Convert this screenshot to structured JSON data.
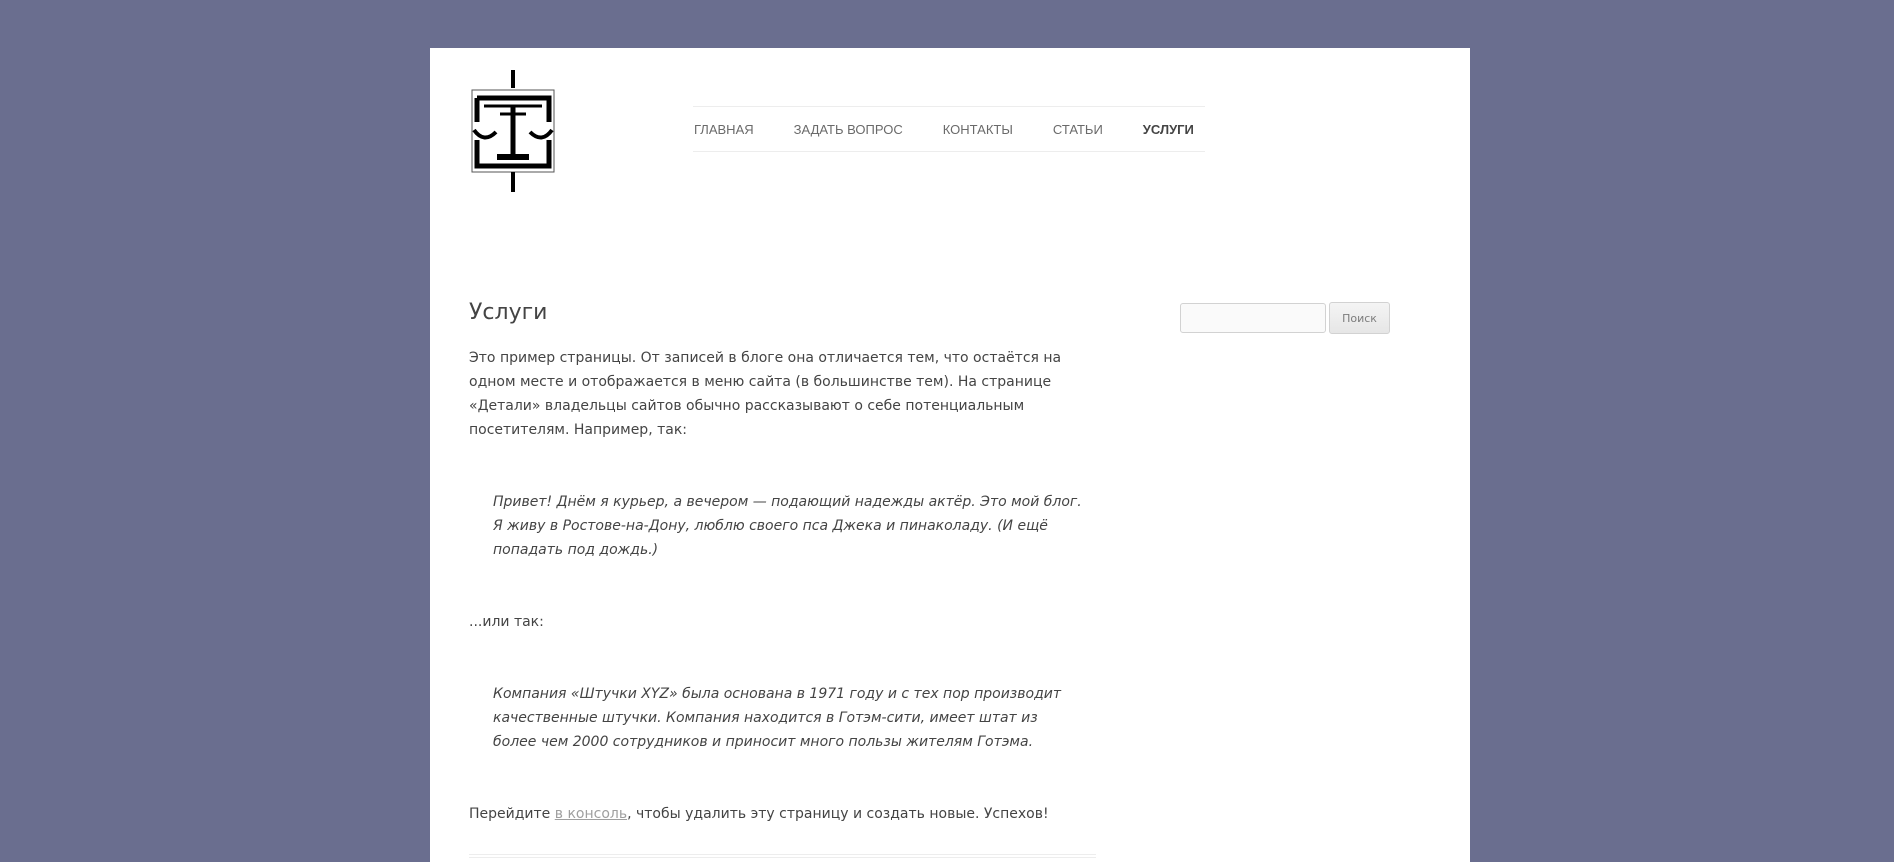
{
  "nav": {
    "items": [
      {
        "label": "Главная",
        "current": false
      },
      {
        "label": "Задать вопрос",
        "current": false
      },
      {
        "label": "Контакты",
        "current": false
      },
      {
        "label": "Статьи",
        "current": false
      },
      {
        "label": "Услуги",
        "current": true
      }
    ]
  },
  "main": {
    "title": "Услуги",
    "intro": "Это пример страницы. От записей в блоге она отличается тем, что остаётся на одном месте и отображается в меню сайта (в большинстве тем). На странице «Детали» владельцы сайтов обычно рассказывают о себе потенциальным посетителям. Например, так:",
    "quote1": "Привет! Днём я курьер, а вечером — подающий надежды актёр. Это мой блог. Я живу в Ростове-на-Дону, люблю своего пса Джека и пинаколаду. (И ещё попадать под дождь.)",
    "or_text": "...или так:",
    "quote2": "Компания «Штучки XYZ» была основана в 1971 году и с тех пор производит качественные штучки. Компания находится в Готэм-сити, имеет штат из более чем 2000 сотрудников и приносит много пользы жителям Готэма.",
    "outro_before": "Перейдите ",
    "outro_link": "в консоль",
    "outro_after": ", чтобы удалить эту страницу и создать новые. Успехов!"
  },
  "sidebar": {
    "search": {
      "value": "",
      "button_label": "Поиск"
    }
  },
  "colors": {
    "background": "#6a6e8f",
    "page": "#ffffff",
    "text": "#444444",
    "link": "#9f9f9f"
  },
  "icons": {
    "logo": "scales-of-justice-logo"
  }
}
